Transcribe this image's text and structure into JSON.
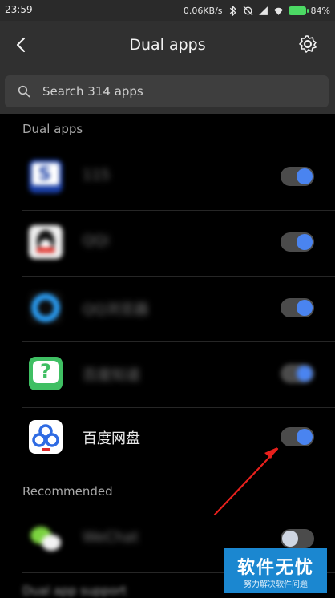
{
  "status_bar": {
    "time": "23:59",
    "speed": "0.06KB/s",
    "battery": "84%"
  },
  "header": {
    "title": "Dual apps"
  },
  "search": {
    "placeholder": "Search 314 apps"
  },
  "sections": {
    "dual_apps": "Dual apps",
    "recommended": "Recommended",
    "support": "Dual app support"
  },
  "apps": [
    {
      "label": "115",
      "enabled": true
    },
    {
      "label": "QQi",
      "enabled": true
    },
    {
      "label": "QQ浏览器",
      "enabled": true
    },
    {
      "label": "百度知道",
      "enabled": true
    },
    {
      "label": "百度网盘",
      "enabled": true
    },
    {
      "label": "WeChat",
      "enabled": false
    }
  ],
  "watermark": {
    "title": "软件无忧",
    "subtitle": "努力解决软件问题"
  },
  "colors": {
    "accent": "#4a84f0",
    "annotation_arrow": "#e8201c",
    "watermark_bg": "#1b87d0"
  }
}
